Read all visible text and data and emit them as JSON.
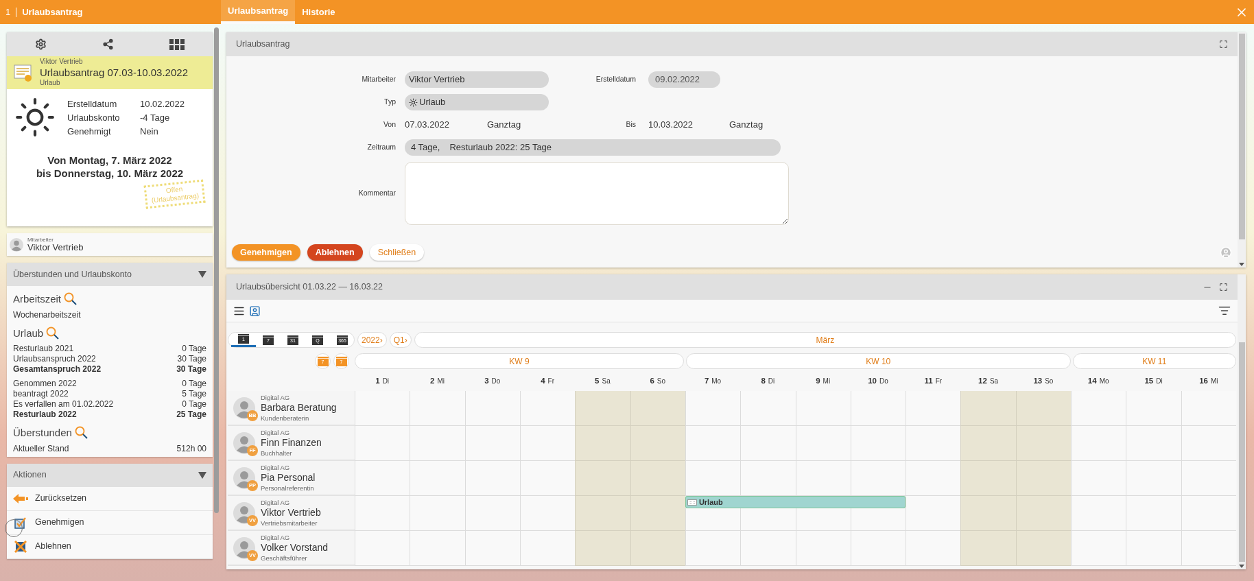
{
  "app_bar": {
    "counter": "1",
    "title": "Urlaubsantrag"
  },
  "tabs": [
    {
      "label": "Urlaubsantrag",
      "selected": true
    },
    {
      "label": "Historie",
      "selected": false
    }
  ],
  "request_card": {
    "employee": "Viktor Vertrieb",
    "title": "Urlaubsantrag 07.03-10.03.2022",
    "type": "Urlaub",
    "details": [
      {
        "label": "Erstelldatum",
        "value": "10.02.2022"
      },
      {
        "label": "Urlaubskonto",
        "value": "-4 Tage"
      },
      {
        "label": "Genehmigt",
        "value": "Nein"
      }
    ],
    "period": [
      "Von Montag, 7. März 2022",
      "bis Donnerstag, 10. März 2022"
    ],
    "stamp": [
      "Offen",
      "(Urlaubsantrag)"
    ]
  },
  "employee_card": {
    "label": "Mitarbeiter",
    "name": "Viktor Vertrieb"
  },
  "account_panel": {
    "title": "Überstunden und Urlaubskonto",
    "expanded": true,
    "sections": [
      {
        "heading": "Arbeitszeit",
        "groups": [
          [
            {
              "label": "Wochenarbeitszeit",
              "bold": false
            }
          ]
        ]
      },
      {
        "heading": "Urlaub",
        "groups": [
          [
            {
              "label": "Resturlaub 2021",
              "value": "0 Tage",
              "bold": false
            },
            {
              "label": "Urlaubsanspruch 2022",
              "value": "30 Tage",
              "bold": false
            },
            {
              "label": "Gesamtanspruch 2022",
              "value": "30 Tage",
              "bold": true
            }
          ],
          [
            {
              "label": "Genommen 2022",
              "value": "0 Tage",
              "bold": false
            },
            {
              "label": "beantragt 2022",
              "value": "5 Tage",
              "bold": false
            },
            {
              "label": "Es verfallen am 01.02.2022",
              "value": "0 Tage",
              "bold": false
            },
            {
              "label": "Resturlaub 2022",
              "value": "25 Tage",
              "bold": true
            }
          ]
        ]
      },
      {
        "heading": "Überstunden",
        "groups": [
          [
            {
              "label": "Aktueller Stand",
              "value": "512h 00",
              "bold": false
            }
          ]
        ]
      }
    ]
  },
  "actions_panel": {
    "title": "Aktionen",
    "expanded": true,
    "items": [
      {
        "label": "Zurücksetzen",
        "kind": "reset"
      },
      {
        "label": "Genehmigen",
        "kind": "approve"
      },
      {
        "label": "Ablehnen",
        "kind": "reject"
      }
    ]
  },
  "form": {
    "title": "Urlaubsantrag",
    "employee": {
      "label": "Mitarbeiter",
      "value": "Viktor Vertrieb"
    },
    "created": {
      "label": "Erstelldatum",
      "value": "09.02.2022"
    },
    "type": {
      "label": "Typ",
      "value": "Urlaub"
    },
    "from": {
      "label": "Von",
      "date": "07.03.2022",
      "span": "Ganztag"
    },
    "to": {
      "label": "Bis",
      "date": "10.03.2022",
      "span": "Ganztag"
    },
    "period": {
      "label": "Zeitraum",
      "parts": [
        "4 Tage,",
        "Resturlaub 2022: 25 Tage"
      ]
    },
    "comment": {
      "label": "Kommentar"
    },
    "buttons": [
      {
        "label": "Genehmigen",
        "kind": "primary"
      },
      {
        "label": "Ablehnen",
        "kind": "danger"
      },
      {
        "label": "Schließen",
        "kind": "secondary"
      }
    ]
  },
  "calendar": {
    "title": "Urlaubsübersicht 01.03.22 — 16.03.22",
    "views": [
      {
        "label": "1",
        "selected": true
      },
      {
        "label": "7",
        "selected": false
      },
      {
        "label": "31",
        "selected": false
      },
      {
        "label": "Q",
        "selected": false
      },
      {
        "label": "365",
        "selected": false
      }
    ],
    "year": "2022›",
    "quarter": "Q1›",
    "month": "März",
    "jump_buttons": [
      "7",
      "7"
    ],
    "weeks": [
      {
        "label": "KW 9",
        "days": [
          {
            "day": "1",
            "weekday": "Di",
            "weekend": false
          },
          {
            "day": "2",
            "weekday": "Mi",
            "weekend": false
          },
          {
            "day": "3",
            "weekday": "Do",
            "weekend": false
          },
          {
            "day": "4",
            "weekday": "Fr",
            "weekend": false
          },
          {
            "day": "5",
            "weekday": "Sa",
            "weekend": true
          },
          {
            "day": "6",
            "weekday": "So",
            "weekend": true
          }
        ]
      },
      {
        "label": "KW 10",
        "days": [
          {
            "day": "7",
            "weekday": "Mo",
            "weekend": false
          },
          {
            "day": "8",
            "weekday": "Di",
            "weekend": false
          },
          {
            "day": "9",
            "weekday": "Mi",
            "weekend": false
          },
          {
            "day": "10",
            "weekday": "Do",
            "weekend": false
          },
          {
            "day": "11",
            "weekday": "Fr",
            "weekend": false
          },
          {
            "day": "12",
            "weekday": "Sa",
            "weekend": true
          },
          {
            "day": "13",
            "weekday": "So",
            "weekend": true
          }
        ]
      },
      {
        "label": "KW 11",
        "days": [
          {
            "day": "14",
            "weekday": "Mo",
            "weekend": false
          },
          {
            "day": "15",
            "weekday": "Di",
            "weekend": false
          },
          {
            "day": "16",
            "weekday": "Mi",
            "weekend": false
          }
        ]
      }
    ],
    "employees": [
      {
        "company": "Digital AG",
        "name": "Barbara Beratung",
        "role": "Kundenberaterin",
        "initials": "BB"
      },
      {
        "company": "Digital AG",
        "name": "Finn Finanzen",
        "role": "Buchhalter",
        "initials": "FF"
      },
      {
        "company": "Digital AG",
        "name": "Pia Personal",
        "role": "Personalreferentin",
        "initials": "PP"
      },
      {
        "company": "Digital AG",
        "name": "Viktor Vertrieb",
        "role": "Vertriebsmitarbeiter",
        "initials": "VV",
        "absence": {
          "label": "Urlaub",
          "covers": [
            false,
            false,
            false,
            false,
            false,
            false,
            true,
            true,
            true,
            true,
            false,
            false,
            false,
            false,
            false,
            false
          ]
        }
      },
      {
        "company": "Digital AG",
        "name": "Volker Vorstand",
        "role": "Geschäftsführer",
        "initials": "VV"
      }
    ]
  }
}
